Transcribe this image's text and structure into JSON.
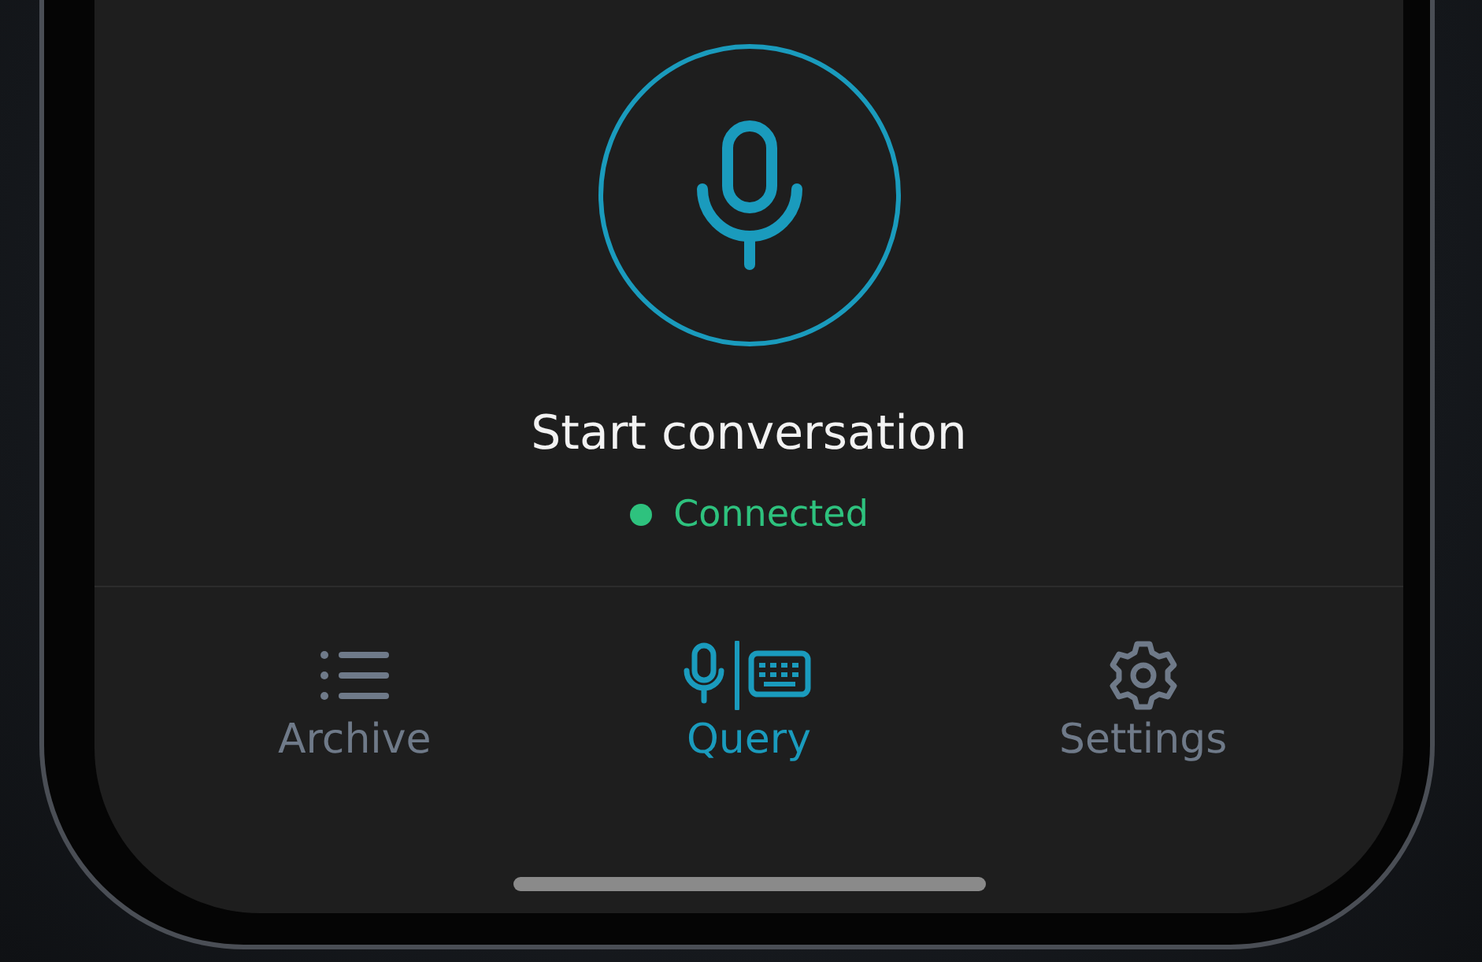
{
  "prompt": {
    "title": "Start conversation"
  },
  "status": {
    "label": "Connected",
    "connected": true
  },
  "tabs": [
    {
      "label": "Archive",
      "kind": "list",
      "selected": false
    },
    {
      "label": "Query",
      "kind": "voice",
      "selected": true
    },
    {
      "label": "Settings",
      "kind": "gear",
      "selected": false
    }
  ]
}
